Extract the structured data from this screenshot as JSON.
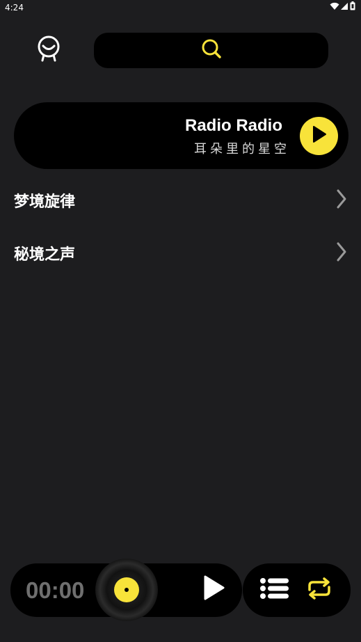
{
  "status_bar": {
    "time": "4:24",
    "icons": [
      "wifi-icon",
      "signal-icon",
      "battery-icon"
    ]
  },
  "header": {
    "profile_icon": "smiley-profile-icon",
    "search_icon": "search-icon"
  },
  "featured_radio": {
    "title": "Radio Radio",
    "subtitle": "耳朵里的星空",
    "play_icon": "play-icon"
  },
  "categories": [
    {
      "label": "梦境旋律",
      "icon": "chevron-right-icon"
    },
    {
      "label": "秘境之声",
      "icon": "chevron-right-icon"
    }
  ],
  "player": {
    "time": "00:00",
    "disc_icon": "vinyl-disc-icon",
    "play_icon": "play-icon",
    "playlist_icon": "playlist-icon",
    "repeat_icon": "repeat-icon"
  },
  "colors": {
    "background": "#1d1d1f",
    "card": "#000000",
    "accent": "#f8e33a",
    "muted_text": "#6f6f6f"
  }
}
